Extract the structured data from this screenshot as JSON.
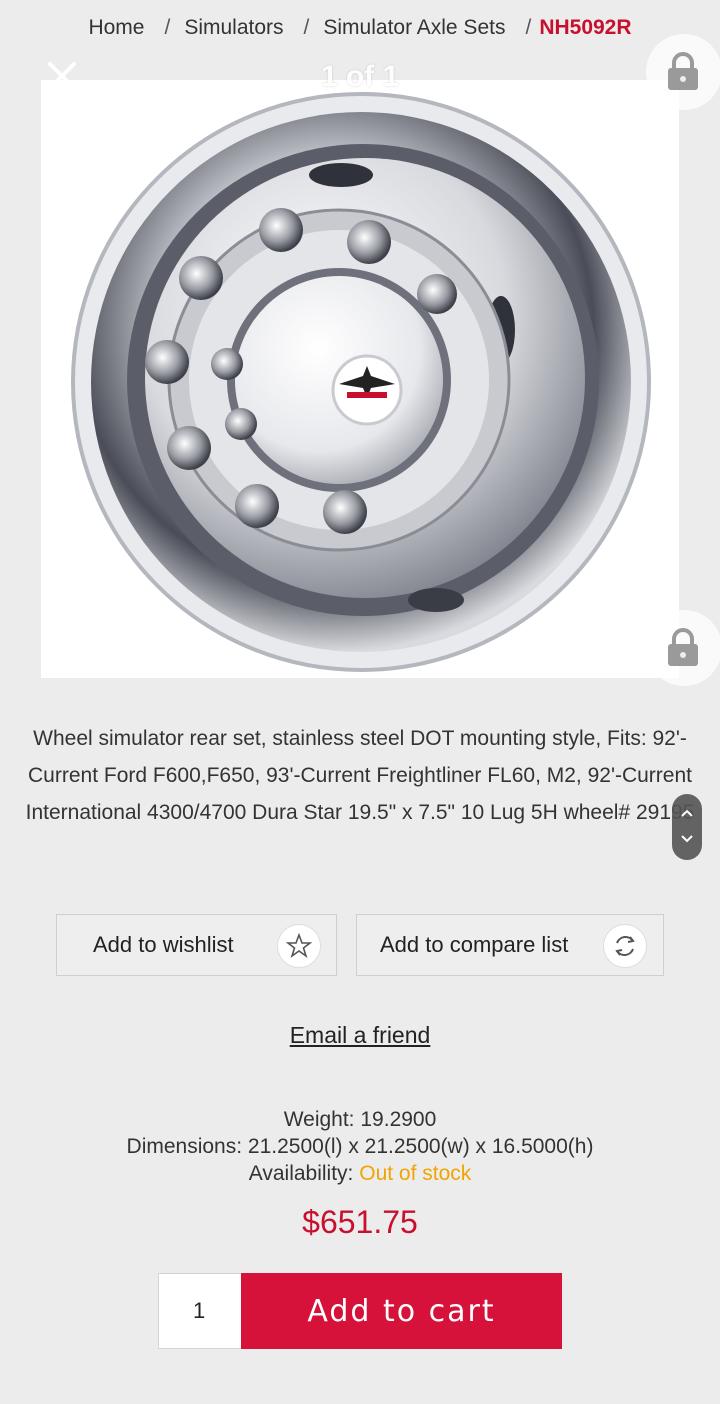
{
  "breadcrumb": {
    "items": [
      "Home",
      "Simulators",
      "Simulator Axle Sets"
    ],
    "separator": "/",
    "current": "NH5092R"
  },
  "gallery": {
    "counter": "1 of 1",
    "image_alt": "Stainless steel wheel simulator",
    "icons": [
      "close-icon",
      "lock-icon"
    ]
  },
  "product": {
    "description": "Wheel simulator rear set, stainless steel DOT mounting style, Fits: 92'-Current Ford F600,F650, 93'-Current Freightliner FL60, M2, 92'-Current International 4300/4700 Dura Star 19.5\" x 7.5\" 10 Lug 5H wheel# 29195",
    "wishlist_label": "Add to wishlist",
    "compare_label": "Add to compare list",
    "email_label": "Email a friend",
    "weight_label": "Weight:",
    "weight": "19.2900",
    "dimensions_label": "Dimensions:",
    "dimensions": "21.2500(l) x 21.2500(w) x 16.5000(h)",
    "availability_label": "Availability:",
    "availability": "Out of stock",
    "price": "$651.75",
    "quantity": "1",
    "cart_label": "Add to cart"
  },
  "colors": {
    "accent": "#c8102e",
    "cart_button": "#d6113a",
    "stock_warning": "#f0a500",
    "background": "#ececec"
  }
}
